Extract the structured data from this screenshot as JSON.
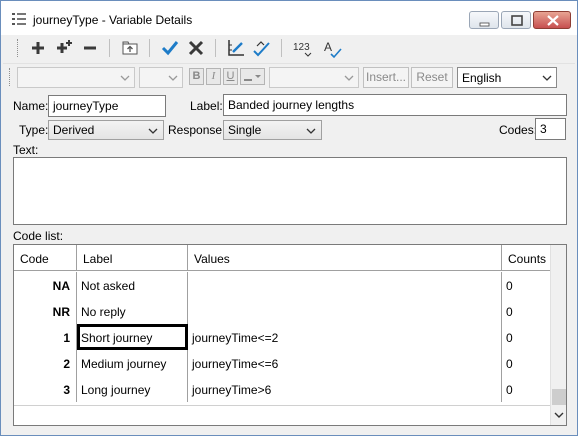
{
  "window": {
    "title": "journeyType - Variable Details"
  },
  "toolbar2": {
    "insert_label": "Insert...",
    "reset_label": "Reset",
    "language_value": "English",
    "bold_label": "B",
    "italic_label": "I",
    "underline_label": "U"
  },
  "form": {
    "name_label": "Name:",
    "name_value": "journeyType",
    "label_label": "Label:",
    "label_value": "Banded journey lengths",
    "type_label": "Type:",
    "type_value": "Derived",
    "response_label": "Response:",
    "response_value": "Single",
    "codes_label": "Codes:",
    "codes_value": "3",
    "text_label": "Text:",
    "codelist_label": "Code list:"
  },
  "grid": {
    "headers": [
      "Code",
      "Label",
      "Values",
      "Counts"
    ],
    "rows": [
      {
        "code": "NA",
        "label": "Not asked",
        "values": "",
        "counts": "0"
      },
      {
        "code": "NR",
        "label": "No reply",
        "values": "",
        "counts": "0"
      },
      {
        "code": "1",
        "label": "Short journey",
        "values": "journeyTime<=2",
        "counts": "0"
      },
      {
        "code": "2",
        "label": "Medium journey",
        "values": "journeyTime<=6",
        "counts": "0"
      },
      {
        "code": "3",
        "label": "Long journey",
        "values": "journeyTime>6",
        "counts": "0"
      }
    ]
  },
  "icons": {
    "title_icon": "variable-details-icon",
    "add": "plus-icon",
    "add_multiple": "plus-stack-icon",
    "remove": "minus-icon",
    "up_level": "folder-up-icon",
    "accept": "checkmark-icon",
    "cancel": "cross-icon",
    "edit": "edit-ruler-icon",
    "validate": "spellcheck-icon",
    "numbering": "numbering-icon",
    "font": "font-check-icon"
  },
  "colors": {
    "accent_blue": "#1e7cc8",
    "close_red": "#c75050"
  }
}
